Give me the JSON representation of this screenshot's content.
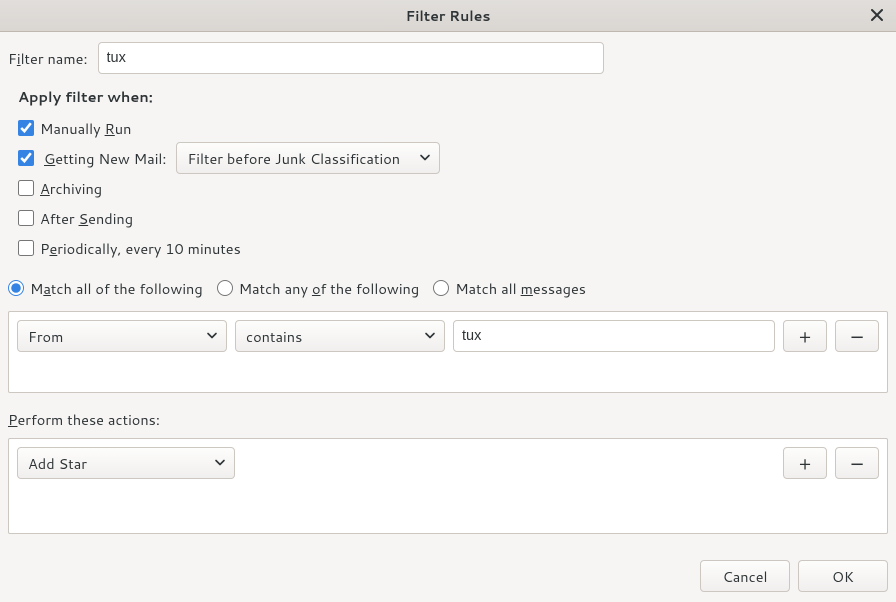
{
  "window": {
    "title": "Filter Rules"
  },
  "filter": {
    "label_pre": "F",
    "label_acc": "i",
    "label_post": "lter name:",
    "name": "tux"
  },
  "apply_when": {
    "title": "Apply filter when:"
  },
  "manual": {
    "checked": true,
    "pre": "Manually ",
    "acc": "R",
    "post": "un"
  },
  "newmail": {
    "checked": true,
    "acc": "G",
    "post": "etting New Mail:",
    "select_value": "Filter before Junk Classification"
  },
  "archiving": {
    "checked": false,
    "acc": "A",
    "post": "rchiving"
  },
  "after_sending": {
    "checked": false,
    "pre": "After ",
    "acc": "S",
    "post": "ending"
  },
  "periodic": {
    "checked": false,
    "pre": "P",
    "acc": "e",
    "post": "riodically, every 10 minutes"
  },
  "match": {
    "all": {
      "checked": true,
      "pre": "M",
      "acc": "a",
      "post": "tch all of the following"
    },
    "any": {
      "checked": false,
      "pre": "Match any ",
      "acc": "o",
      "post": "f the following"
    },
    "allmsg": {
      "checked": false,
      "pre": "Match all ",
      "acc": "m",
      "post": "essages"
    }
  },
  "condition": {
    "field": "From",
    "op": "contains",
    "value": "tux",
    "add": "+",
    "remove": "−"
  },
  "perform": {
    "label_acc": "P",
    "label_post": "erform these actions:"
  },
  "action": {
    "value": "Add Star",
    "add": "+",
    "remove": "−"
  },
  "buttons": {
    "cancel": "Cancel",
    "ok": "OK"
  }
}
